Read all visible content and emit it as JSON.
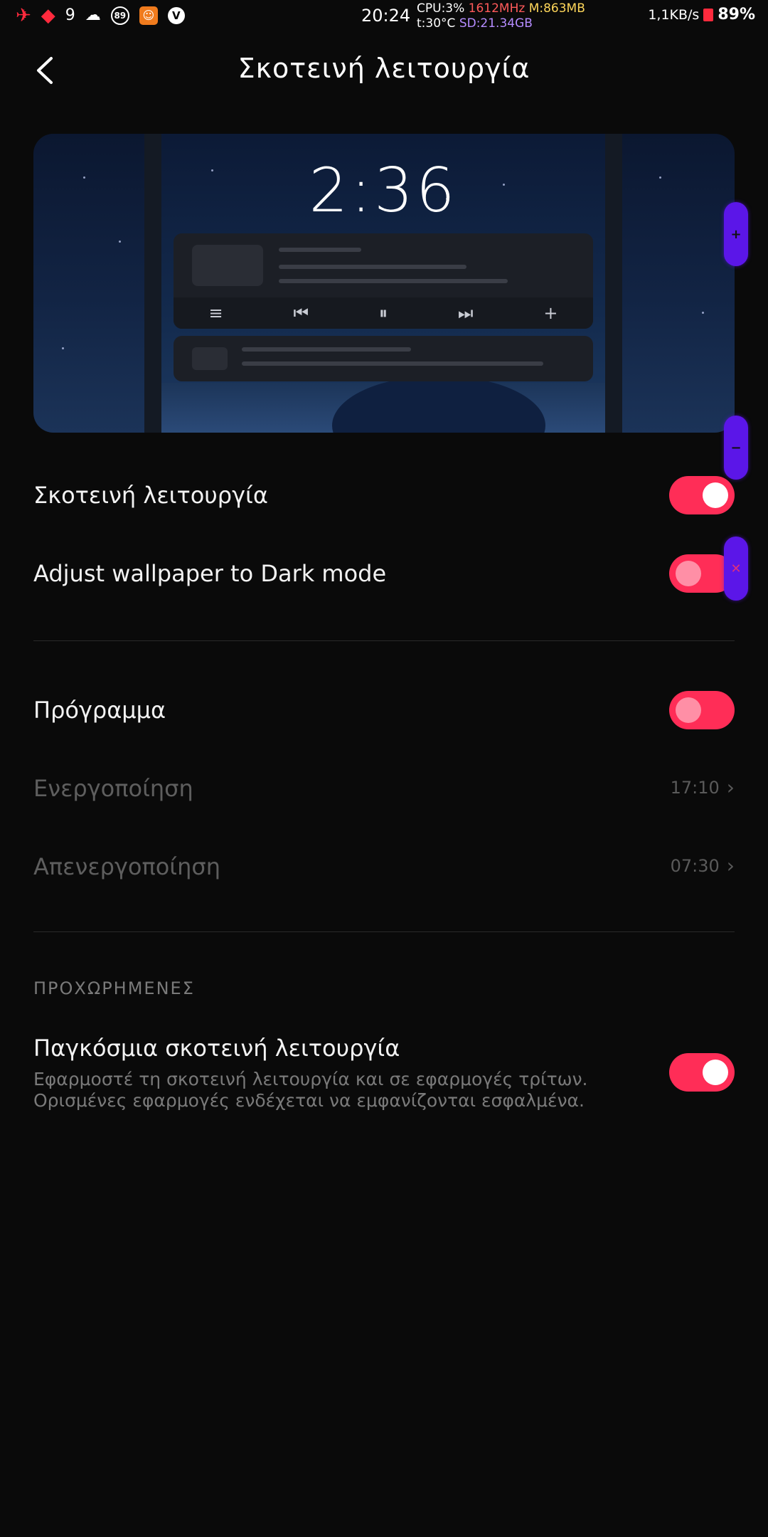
{
  "status_bar": {
    "time": "20:24",
    "cpu": "CPU:3%",
    "freq": "1612MHz",
    "mem": "M:863MB",
    "temp": "t:30°C",
    "sd": "SD:21.34GB",
    "signal_number": "9",
    "notif_badge": "89",
    "net_speed": "1,1KB/s",
    "battery": "89%",
    "icons": [
      "airplane-icon",
      "wifi-icon",
      "cloud-icon",
      "badge-icon",
      "app-icon",
      "v-icon"
    ]
  },
  "header": {
    "title": "Σκοτεινή λειτουργία",
    "back_icon": "back-arrow-icon"
  },
  "preview": {
    "clock": "2:36",
    "controls": [
      "≡",
      "⏮",
      "⏸",
      "⏭",
      "+"
    ]
  },
  "settings": {
    "dark_mode": {
      "label": "Σκοτεινή λειτουργία",
      "state": "on"
    },
    "wallpaper": {
      "label": "Adjust wallpaper to Dark mode",
      "state": "on-dimmed"
    },
    "schedule": {
      "label": "Πρόγραμμα",
      "state": "on-dimmed"
    },
    "activate": {
      "label": "Ενεργοποίηση",
      "value": "17:10"
    },
    "deactivate": {
      "label": "Απενεργοποίηση",
      "value": "07:30"
    }
  },
  "advanced": {
    "section_title": "ΠΡΟΧΩΡΗΜΕΝΕΣ",
    "global_title": "Παγκόσμια σκοτεινή λειτουργία",
    "global_desc": "Εφαρμοστέ τη σκοτεινή λειτουργία και σε εφαρμογές τρίτων. Ορισμένες εφαρμογές ενδέχεται να εμφανίζονται εσφαλμένα.",
    "global_state": "on"
  },
  "colors": {
    "accent": "#ff2d57",
    "background": "#0a0a0a",
    "overlay": "#5b16e8"
  }
}
